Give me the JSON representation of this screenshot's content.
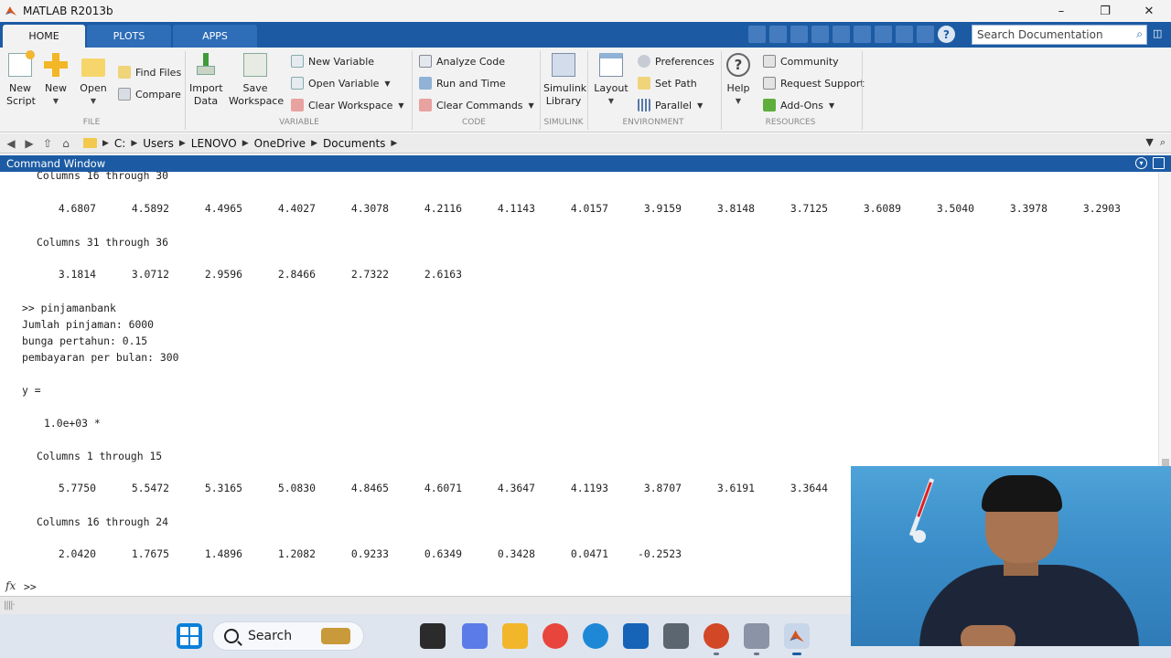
{
  "window": {
    "title": "MATLAB R2013b",
    "controls": {
      "minimize": "–",
      "maximize": "❐",
      "close": "✕"
    }
  },
  "ribbon": {
    "tabs": [
      "HOME",
      "PLOTS",
      "APPS"
    ],
    "active_tab": "HOME",
    "search_placeholder": "Search Documentation",
    "groups": {
      "file": {
        "label": "FILE",
        "new_script": [
          "New",
          "Script"
        ],
        "new": "New",
        "open": "Open",
        "find_files": "Find Files",
        "compare": "Compare"
      },
      "variable": {
        "label": "VARIABLE",
        "import_data": [
          "Import",
          "Data"
        ],
        "save_workspace": [
          "Save",
          "Workspace"
        ],
        "new_variable": "New Variable",
        "open_variable": "Open Variable",
        "clear_workspace": "Clear Workspace"
      },
      "code": {
        "label": "CODE",
        "analyze_code": "Analyze Code",
        "run_and_time": "Run and Time",
        "clear_commands": "Clear Commands"
      },
      "simulink": {
        "label": "SIMULINK",
        "library": [
          "Simulink",
          "Library"
        ]
      },
      "environment": {
        "label": "ENVIRONMENT",
        "layout": "Layout",
        "preferences": "Preferences",
        "set_path": "Set Path",
        "parallel": "Parallel"
      },
      "resources": {
        "label": "RESOURCES",
        "help": "Help",
        "community": "Community",
        "request_support": "Request Support",
        "add_ons": "Add-Ons"
      }
    }
  },
  "address": {
    "crumbs": [
      "C:",
      "Users",
      "LENOVO",
      "OneDrive",
      "Documents"
    ]
  },
  "command_window": {
    "title": "Command Window",
    "block1_header": "Columns 16 through 30",
    "block1_values": [
      "4.6807",
      "4.5892",
      "4.4965",
      "4.4027",
      "4.3078",
      "4.2116",
      "4.1143",
      "4.0157",
      "3.9159",
      "3.8148",
      "3.7125",
      "3.6089",
      "3.5040",
      "3.3978",
      "3.2903"
    ],
    "block2_header": "Columns 31 through 36",
    "block2_values": [
      "3.1814",
      "3.0712",
      "2.9596",
      "2.8466",
      "2.7322",
      "2.6163"
    ],
    "cmd_prompt": ">> pinjamanbank",
    "input_lines": [
      "Jumlah pinjaman: 6000",
      "bunga pertahun: 0.15",
      "pembayaran per bulan: 300"
    ],
    "var_assign": "y =",
    "scale_factor": "1.0e+03 *",
    "block3_header": "Columns 1 through 15",
    "block3_values": [
      "5.7750",
      "5.5472",
      "5.3165",
      "5.0830",
      "4.8465",
      "4.6071",
      "4.3647",
      "4.1193",
      "3.8707",
      "3.6191",
      "3.3644"
    ],
    "block4_header": "Columns 16 through 24",
    "block4_values": [
      "2.0420",
      "1.7675",
      "1.4896",
      "1.2082",
      "0.9233",
      "0.6349",
      "0.3428",
      "0.0471",
      "-0.2523"
    ],
    "fx_symbol": "fx",
    "active_prompt": ">>"
  },
  "taskbar": {
    "search_label": "Search"
  }
}
